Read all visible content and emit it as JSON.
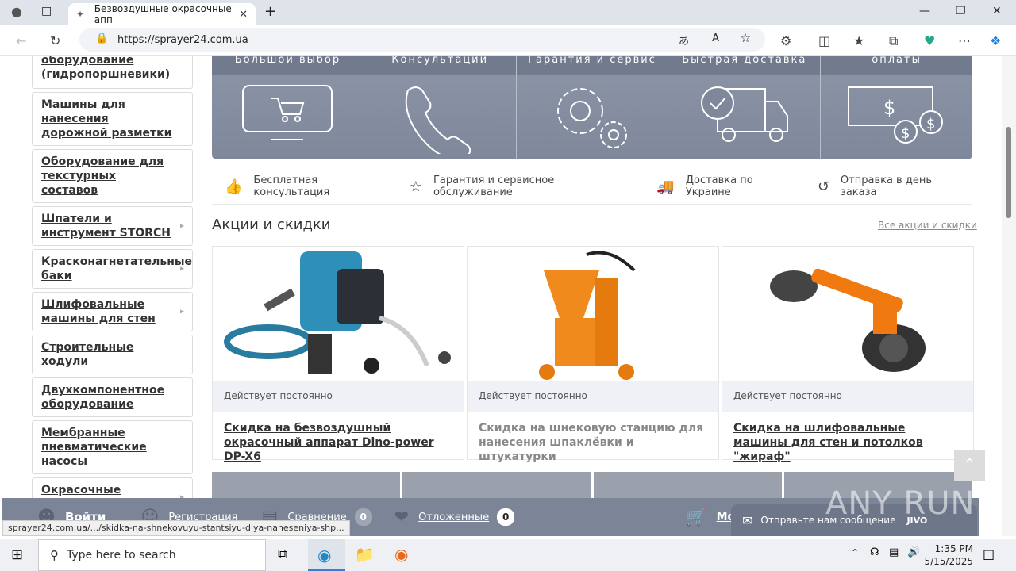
{
  "browser": {
    "tab_title": "Безвоздушные окрасочные апп",
    "url": "https://sprayer24.com.ua",
    "status_url": "sprayer24.com.ua/.../skidka-na-shnekovuyu-stantsiyu-dlya-naneseniya-shp..."
  },
  "sidebar": {
    "items": [
      {
        "label": "оборудование (гидропоршневики)",
        "has_arrow": false
      },
      {
        "label": "Машины для нанесения дорожной разметки",
        "has_arrow": false
      },
      {
        "label": "Оборудование для текстурных составов",
        "has_arrow": false
      },
      {
        "label": "Шпатели и инструмент STORCH",
        "has_arrow": true
      },
      {
        "label": "Красконагнетательные баки",
        "has_arrow": true
      },
      {
        "label": "Шлифовальные машины для стен",
        "has_arrow": true
      },
      {
        "label": "Строительные ходули",
        "has_arrow": false
      },
      {
        "label": "Двухкомпонентное оборудование",
        "has_arrow": false
      },
      {
        "label": "Мембранные пневматические насосы",
        "has_arrow": false
      },
      {
        "label": "Окрасочные пистолеты",
        "has_arrow": true
      }
    ]
  },
  "banner": {
    "cells": [
      {
        "title": "Большой выбор",
        "icon": "monitor-cart-icon"
      },
      {
        "title": "Консультации",
        "icon": "phone-icon"
      },
      {
        "title": "Гарантия и сервис",
        "icon": "gears-icon"
      },
      {
        "title": "Быстрая доставка",
        "icon": "truck-icon"
      },
      {
        "title": "оплаты",
        "icon": "money-icon"
      }
    ]
  },
  "features": [
    {
      "label": "Бесплатная консультация",
      "icon": "thumbs-up-icon"
    },
    {
      "label": "Гарантия и сервисное обслуживание",
      "icon": "star-icon"
    },
    {
      "label": "Доставка по Украине",
      "icon": "truck-icon"
    },
    {
      "label": "Отправка в день заказа",
      "icon": "history-icon"
    }
  ],
  "promos": {
    "title": "Акции и скидки",
    "all_link": "Все акции и скидки",
    "cards": [
      {
        "status": "Действует постоянно",
        "title": "Скидка на безвоздушный окрасочный аппарат Dino-power DP-X6"
      },
      {
        "status": "Действует постоянно",
        "title": "Скидка на шнековую станцию для нанесения шпаклёвки и штукатурки"
      },
      {
        "status": "Действует постоянно",
        "title": "Скидка на шлифовальные машины для стен и потолков \"жираф\""
      }
    ]
  },
  "bottom_bar": {
    "login": "Войти",
    "register": "Регистрация",
    "compare": "Сравнение",
    "compare_count": "0",
    "saved": "Отложенные",
    "saved_count": "0",
    "cart": "Моя к",
    "chat": "Отправьте нам сообщение",
    "chat_brand": "JIVO"
  },
  "taskbar": {
    "search_placeholder": "Type here to search",
    "time": "1:35 PM",
    "date": "5/15/2025"
  },
  "watermark": "ANY RUN"
}
